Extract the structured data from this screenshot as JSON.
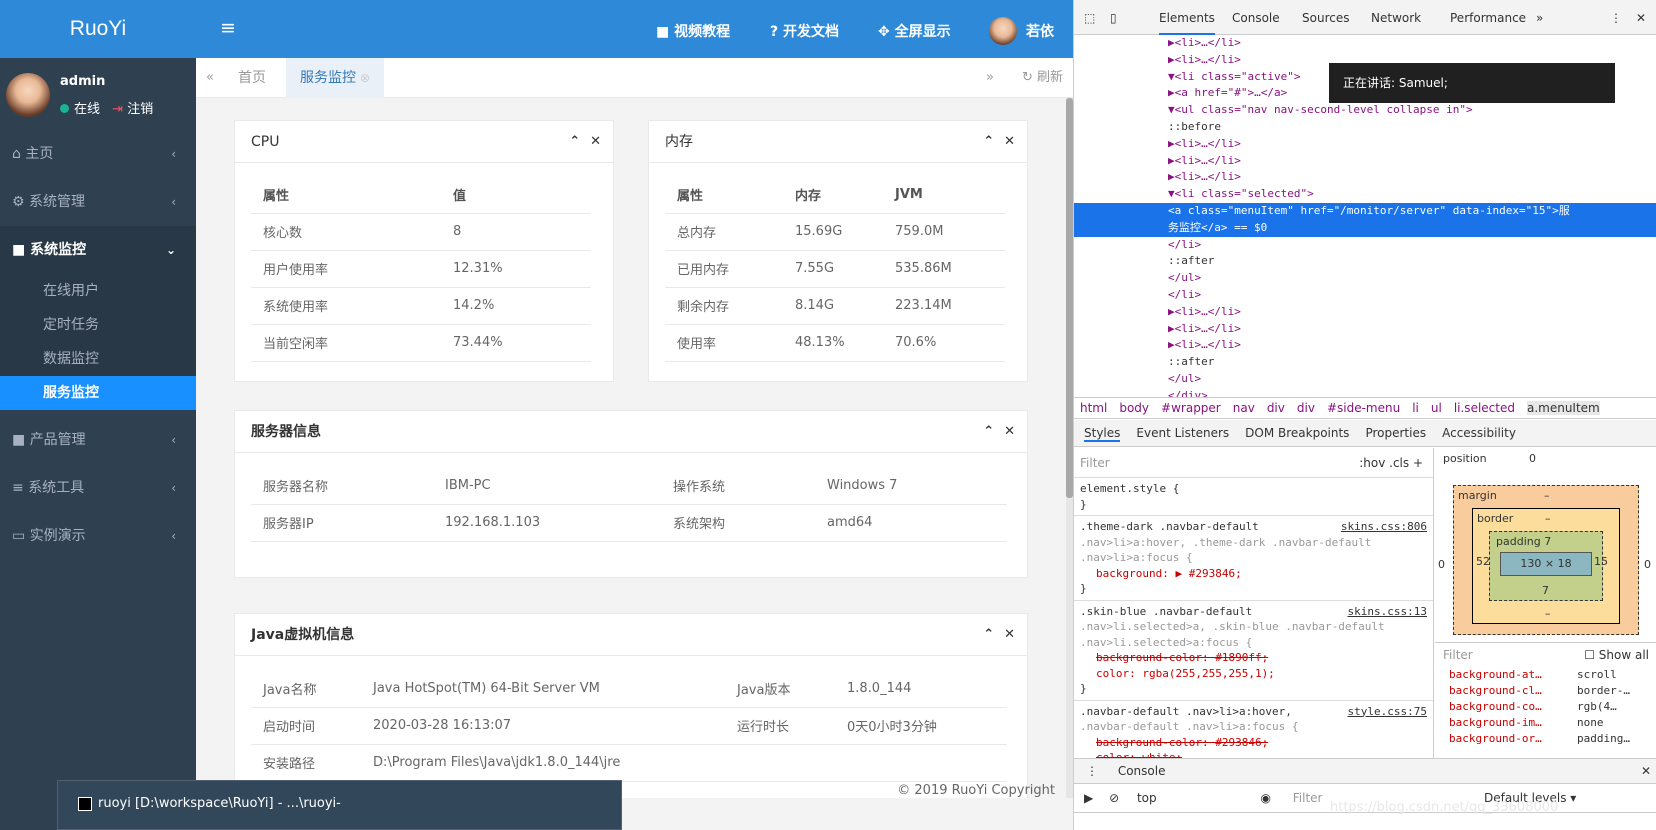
{
  "sidebar": {
    "brand": "RuoYi",
    "user": {
      "name": "admin",
      "status": "在线",
      "logout": "注销"
    },
    "menu": [
      {
        "label": "主页",
        "icon": "home-icon",
        "glyph": "⌂"
      },
      {
        "label": "系统管理",
        "icon": "gear-icon",
        "glyph": "⚙"
      },
      {
        "label": "系统监控",
        "icon": "video-icon",
        "glyph": "■",
        "open": true
      },
      {
        "label": "产品管理",
        "icon": "video-icon",
        "glyph": "■"
      },
      {
        "label": "系统工具",
        "icon": "bars-icon",
        "glyph": "≡"
      },
      {
        "label": "实例演示",
        "icon": "desktop-icon",
        "glyph": "▭"
      }
    ],
    "submenu": [
      "在线用户",
      "定时任务",
      "数据监控",
      "服务监控"
    ]
  },
  "topbar": {
    "video": "视频教程",
    "docs": "开发文档",
    "fullscreen": "全屏显示",
    "user": "若依"
  },
  "tabs": {
    "home": "首页",
    "current": "服务监控",
    "refresh": "刷新"
  },
  "cpu": {
    "title": "CPU",
    "headers": [
      "属性",
      "值"
    ],
    "rows": [
      [
        "核心数",
        "8"
      ],
      [
        "用户使用率",
        "12.31%"
      ],
      [
        "系统使用率",
        "14.2%"
      ],
      [
        "当前空闲率",
        "73.44%"
      ]
    ]
  },
  "mem": {
    "title": "内存",
    "headers": [
      "属性",
      "内存",
      "JVM"
    ],
    "rows": [
      [
        "总内存",
        "15.69G",
        "759.0M"
      ],
      [
        "已用内存",
        "7.55G",
        "535.86M"
      ],
      [
        "剩余内存",
        "8.14G",
        "223.14M"
      ],
      [
        "使用率",
        "48.13%",
        "70.6%"
      ]
    ]
  },
  "server": {
    "title": "服务器信息",
    "rows": [
      [
        "服务器名称",
        "IBM-PC",
        "操作系统",
        "Windows 7"
      ],
      [
        "服务器IP",
        "192.168.1.103",
        "系统架构",
        "amd64"
      ]
    ]
  },
  "jvm": {
    "title": "Java虚拟机信息",
    "rows": [
      [
        "Java名称",
        "Java HotSpot(TM) 64-Bit Server VM",
        "Java版本",
        "1.8.0_144"
      ],
      [
        "启动时间",
        "2020-03-28 16:13:07",
        "运行时长",
        "0天0小时3分钟"
      ],
      [
        "安装路径",
        "D:\\Program Files\\Java\\jdk1.8.0_144\\jre",
        "",
        ""
      ]
    ]
  },
  "footer": "© 2019 RuoYi Copyright",
  "taskbar": "ruoyi [D:\\workspace\\RuoYi] - ...\\ruoyi-quartz\\src\\main\\java\\com\\ruoyi\\quartz\\task...",
  "devtools": {
    "tabs": [
      "Elements",
      "Console",
      "Sources",
      "Network",
      "Performance",
      "»"
    ],
    "speaking": "正在讲话: Samuel;",
    "dom": [
      "▶<li>…</li>",
      "▶<li>…</li>",
      "▼<li class=\"active\">",
      "  ▶<a href=\"#\">…</a>",
      "  ▼<ul class=\"nav nav-second-level collapse in\">",
      "      ::before",
      "    ▶<li>…</li>",
      "    ▶<li>…</li>",
      "    ▶<li>…</li>",
      "    ▼<li class=\"selected\">",
      "        <a class=\"menuItem\" href=\"/monitor/server\" data-index=\"15\">服",
      "        务监控</a> == $0",
      "      </li>",
      "      ::after",
      "    </ul>",
      "  </li>",
      "▶<li>…</li>",
      "▶<li>…</li>",
      "▶<li>…</li>",
      "  ::after",
      "</ul>",
      "</div>"
    ],
    "crumbs": [
      "html",
      "body",
      "#wrapper",
      "nav",
      "div",
      "div",
      "#side-menu",
      "li",
      "ul",
      "li.selected",
      "a.menuItem"
    ],
    "subtabs": [
      "Styles",
      "Event Listeners",
      "DOM Breakpoints",
      "Properties",
      "Accessibility"
    ],
    "filter": "Filter",
    "hov": ":hov  .cls  +",
    "rules": [
      {
        "sel": "element.style {",
        "lines": [
          "}"
        ],
        "src": ""
      },
      {
        "sel": ".theme-dark .navbar-default",
        "extra": [
          ".nav>li>a:hover, .theme-dark .navbar-default",
          ".nav>li>a:focus {"
        ],
        "props": [
          "background: ▶ #293846;"
        ],
        "src": "skins.css:806"
      },
      {
        "sel": ".skin-blue .navbar-default",
        "extra": [
          ".nav>li.selected>a, .skin-blue .navbar-default",
          ".nav>li.selected>a:focus {"
        ],
        "props": [
          "background-color: #1890ff;",
          "color: rgba(255,255,255,1);"
        ],
        "src": "skins.css:13"
      },
      {
        "sel": ".navbar-default .nav>li>a:hover,",
        "extra": [
          ".navbar-default .nav>li>a:focus {"
        ],
        "props": [
          "background-color: #293846;",
          "color: white;"
        ],
        "src": "style.css:75"
      }
    ],
    "boxmodel": {
      "position": "position",
      "posval": "0",
      "margin": "margin",
      "border": "border",
      "padding": "padding 7",
      "content": "130 × 18",
      "left": "52",
      "right": "15",
      "bottom": "7",
      "m": "–",
      "outerL": "0",
      "outerR": "0"
    },
    "computed_filter": "Filter",
    "show_all": "Show all",
    "computed": [
      [
        "background-at…",
        "scroll"
      ],
      [
        "background-cl…",
        "border-…"
      ],
      [
        "background-co…",
        "rgb(4…"
      ],
      [
        "background-im…",
        "none"
      ],
      [
        "background-or…",
        "padding…"
      ]
    ],
    "console_label": "Console",
    "console_top": "top",
    "console_filter": "Filter",
    "levels": "Default levels ▾"
  },
  "watermark": "https://blog.csdn.net/qq_33608000"
}
